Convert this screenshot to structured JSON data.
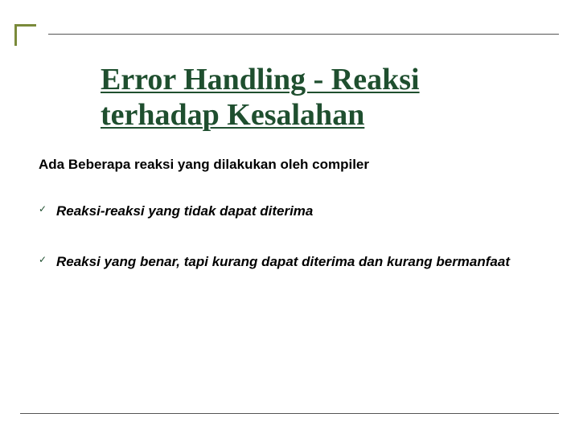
{
  "title": "Error Handling - Reaksi terhadap Kesalahan",
  "intro": "Ada Beberapa reaksi yang dilakukan oleh compiler",
  "bullets": [
    {
      "check": "✓",
      "text": "Reaksi-reaksi yang tidak dapat diterima"
    },
    {
      "check": "✓",
      "text": "Reaksi yang benar, tapi kurang dapat diterima dan kurang bermanfaat"
    }
  ]
}
